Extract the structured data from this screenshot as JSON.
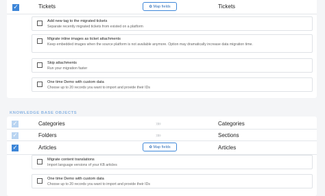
{
  "tickets": {
    "source_label": "Tickets",
    "map_button": "Map fields",
    "target_label": "Tickets",
    "options": [
      {
        "title": "Add new tag to the migrated tickets",
        "desc": "Separate recently migrated tickets from existed on a platform"
      },
      {
        "title": "Migrate inline images as ticket attachments",
        "desc": "Keep embedded images when the source platform is not available anymore. Option may dramatically increase data migration time."
      },
      {
        "title": "Skip attachments",
        "desc": "Run your migration faster"
      },
      {
        "title": "One time Demo with custom data",
        "desc": "Choose up to 20 records you want to import and provide their IDs"
      }
    ]
  },
  "kb": {
    "section_title": "KNOWLEDGE BASE OBJECTS",
    "rows": [
      {
        "source": "Categories",
        "target": "Categories"
      },
      {
        "source": "Folders",
        "target": "Sections"
      },
      {
        "source": "Articles",
        "target": "Articles",
        "map_button": "Map fields"
      }
    ],
    "options": [
      {
        "title": "Migrate content translations",
        "desc": "Import language versions of your KB articles"
      },
      {
        "title": "One time Demo with custom data",
        "desc": "Choose up to 20 records you want to import and provide their IDs"
      }
    ]
  },
  "colors": {
    "accent": "#3d86d8",
    "section": "#8ab4e3"
  },
  "icons": {
    "map": "gear-icon",
    "arrows": "chevrons-right-icon",
    "check": "check-icon"
  }
}
